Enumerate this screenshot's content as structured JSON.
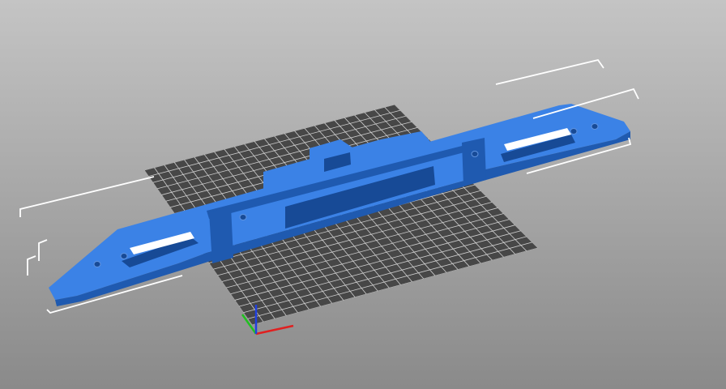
{
  "app": {
    "view": "3d-viewport",
    "colors": {
      "background_top": "#c2c2c2",
      "background_bottom": "#8c8c8c",
      "bed_plate": "#474747",
      "bed_grid_line": "#cfcfcf",
      "model_body": "#2e6fd1",
      "model_top": "#3b82e6",
      "model_side": "#1f5ab0",
      "model_dark": "#174a96",
      "bounding_box": "#ffffff",
      "axis_x": "#e02020",
      "axis_y": "#20c020",
      "axis_z": "#2040e0"
    },
    "icons": {
      "axes": "xyz-axes-icon",
      "bed": "print-bed-grid"
    }
  }
}
